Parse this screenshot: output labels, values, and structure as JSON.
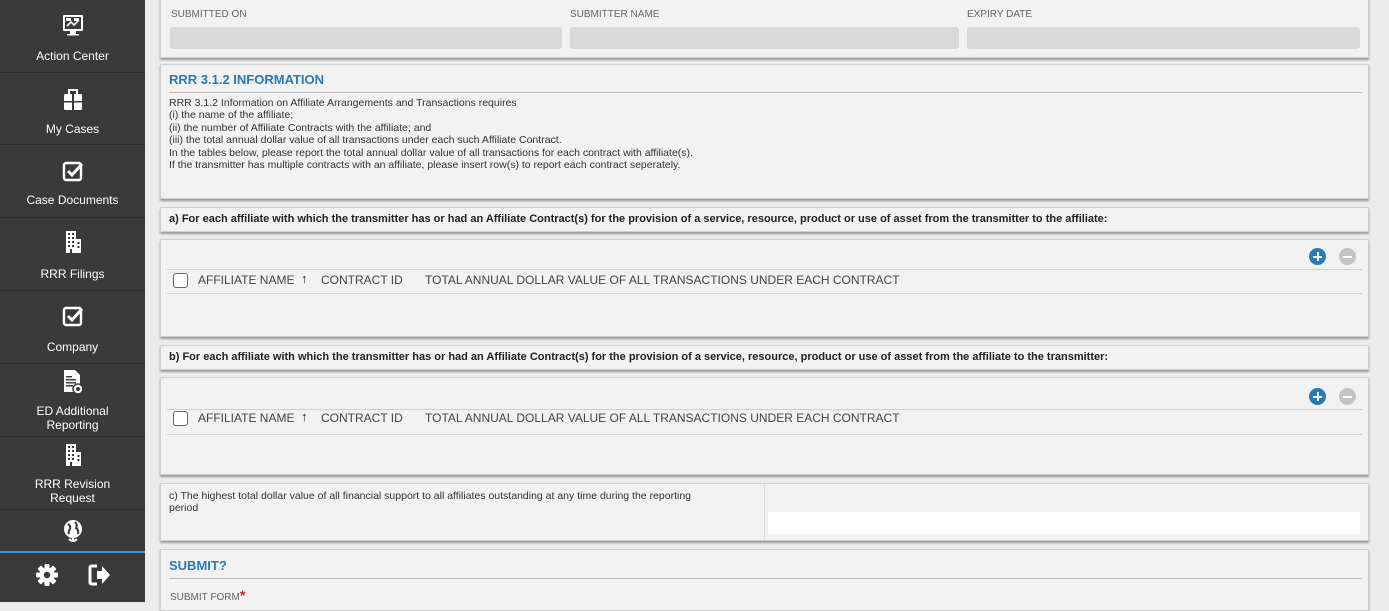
{
  "sidebar": {
    "items": [
      {
        "label_lines": [
          "Action Center"
        ],
        "icon": "action-center-icon"
      },
      {
        "label_lines": [
          "My Cases"
        ],
        "icon": "briefcase-icon"
      },
      {
        "label_lines": [
          "Case Documents"
        ],
        "icon": "checkbox-icon"
      },
      {
        "label_lines": [
          "RRR Filings"
        ],
        "icon": "building-icon"
      },
      {
        "label_lines": [
          "Company"
        ],
        "icon": "checkbox-icon"
      },
      {
        "label_lines": [
          "ED Additional",
          "Reporting"
        ],
        "icon": "report-icon"
      },
      {
        "label_lines": [
          "RRR Revision",
          "Request"
        ],
        "icon": "building-icon"
      },
      {
        "label_lines": [],
        "icon": "globe-icon"
      }
    ],
    "bottom": {
      "settings_icon": "gear-icon",
      "logout_icon": "logout-icon"
    }
  },
  "submission": {
    "submitted_on_label": "SUBMITTED ON",
    "submitted_on_value": "",
    "submitter_name_label": "SUBMITTER NAME",
    "submitter_name_value": "",
    "expiry_date_label": "EXPIRY DATE",
    "expiry_date_value": ""
  },
  "info": {
    "title": "RRR 3.1.2 INFORMATION",
    "lines": [
      "RRR 3.1.2 Information on Affiliate Arrangements and Transactions requires",
      "(i) the name of the affiliate;",
      "(ii) the number of Affiliate Contracts with the affiliate; and",
      "(iii) the total annual dollar value of all transactions under each such Affiliate Contract.",
      "In the tables below, please report the total annual dollar value of all transactions for each contract with affiliate(s).",
      "If the transmitter has multiple contracts with an affiliate, please insert row(s) to report each contract seperately."
    ]
  },
  "section_a": {
    "heading": "a) For each affiliate with which the transmitter has or had an Affiliate Contract(s) for the provision of a service, resource, product or use of asset from the transmitter to the affiliate:",
    "columns": [
      "AFFILIATE NAME",
      "CONTRACT ID",
      "TOTAL ANNUAL DOLLAR VALUE OF ALL TRANSACTIONS UNDER EACH CONTRACT"
    ],
    "sort_indicator": "↑",
    "rows": []
  },
  "section_b": {
    "heading": "b) For each affiliate with which the transmitter has or had an Affiliate Contract(s) for the provision of a service, resource, product or use of asset from the affiliate to the transmitter:",
    "columns": [
      "AFFILIATE NAME",
      "CONTRACT ID",
      "TOTAL ANNUAL DOLLAR VALUE OF ALL TRANSACTIONS UNDER EACH CONTRACT"
    ],
    "sort_indicator": "↑",
    "rows": []
  },
  "section_c": {
    "question_lines": [
      "c) The highest total dollar value of all financial support to all affiliates outstanding at any time during the reporting",
      "period"
    ],
    "value": ""
  },
  "submit": {
    "title": "SUBMIT?",
    "field_label": "SUBMIT FORM",
    "required_mark": "*"
  },
  "colors": {
    "sidebar_bg": "#3a3a3a",
    "accent_blue": "#2a7ab8",
    "panel_bg": "#f2f2f2",
    "page_bg": "#ececec",
    "required_red": "#c0272d"
  }
}
